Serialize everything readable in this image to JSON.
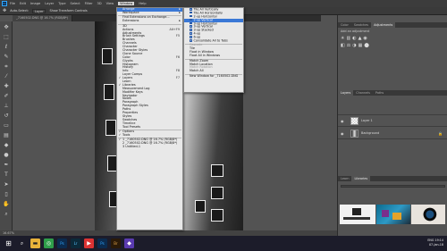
{
  "menubar": {
    "items": [
      "File",
      "Edit",
      "Image",
      "Layer",
      "Type",
      "Select",
      "Filter",
      "3D",
      "View",
      "Window",
      "Help"
    ],
    "active": "Window"
  },
  "optbar": {
    "autoselect": "Auto-Select:",
    "layer": "Layer",
    "transform": "Show Transform Controls"
  },
  "tabs": [
    "_7160502.DNG @ 16.7% (RGB/8*)"
  ],
  "window_menu": [
    {
      "label": "Arrange",
      "arrow": true,
      "hl": true
    },
    {
      "label": "Workspace",
      "arrow": true
    },
    {
      "sep": true
    },
    {
      "label": "Find Extensions on Exchange..."
    },
    {
      "label": "Extensions",
      "arrow": true
    },
    {
      "sep": true
    },
    {
      "label": "3D"
    },
    {
      "label": "Actions",
      "sc": "Alt+F9"
    },
    {
      "label": "Adjustments"
    },
    {
      "label": "Brush Settings",
      "sc": "F5"
    },
    {
      "label": "Brushes"
    },
    {
      "label": "Channels"
    },
    {
      "label": "Character"
    },
    {
      "label": "Character Styles"
    },
    {
      "label": "Clone Source"
    },
    {
      "label": "Color",
      "sc": "F6"
    },
    {
      "label": "Glyphs"
    },
    {
      "label": "Histogram"
    },
    {
      "label": "History"
    },
    {
      "label": "Info",
      "sc": "F8"
    },
    {
      "label": "Layer Comps"
    },
    {
      "label": "Layers",
      "sc": "F7",
      "chk": true
    },
    {
      "label": "Learn"
    },
    {
      "label": "Libraries",
      "chk": true
    },
    {
      "label": "Measurement Log"
    },
    {
      "label": "Modifier Keys"
    },
    {
      "label": "Navigator"
    },
    {
      "label": "Notes"
    },
    {
      "label": "Paragraph"
    },
    {
      "label": "Paragraph Styles"
    },
    {
      "label": "Paths"
    },
    {
      "label": "Properties"
    },
    {
      "label": "Styles"
    },
    {
      "label": "Swatches"
    },
    {
      "label": "Timeline"
    },
    {
      "label": "Tool Presets"
    },
    {
      "sep": true
    },
    {
      "label": "Options",
      "chk": true
    },
    {
      "label": "Tools",
      "chk": true
    },
    {
      "sep": true
    },
    {
      "label": "1 _7160502.DNG @ 16.7% (RGB/8*)",
      "chk": true
    },
    {
      "label": "2 _7160502.DNG @ 16.7% (RGB/8*)"
    },
    {
      "label": "3 Untitled-1"
    }
  ],
  "arrange_menu": [
    {
      "label": "Tile All Vertically",
      "icon": true
    },
    {
      "label": "Tile All Horizontally",
      "icon": true
    },
    {
      "label": "2-up Horizontal",
      "icon": true
    },
    {
      "label": "2-up Vertical",
      "icon": true,
      "hl": true
    },
    {
      "label": "3-up Horizontal",
      "icon": true
    },
    {
      "label": "3-up Vertical",
      "icon": true
    },
    {
      "label": "3-up Stacked",
      "icon": true
    },
    {
      "label": "4-up",
      "icon": true
    },
    {
      "label": "6-up",
      "icon": true
    },
    {
      "label": "Consolidate All to Tabs",
      "icon": true
    },
    {
      "sep": true
    },
    {
      "label": "Cascade",
      "dis": true
    },
    {
      "label": "Tile"
    },
    {
      "label": "Float in Window"
    },
    {
      "label": "Float All in Windows"
    },
    {
      "sep": true
    },
    {
      "label": "Match Zoom"
    },
    {
      "label": "Match Location"
    },
    {
      "label": "Match Rotation",
      "dis": true
    },
    {
      "label": "Match All"
    },
    {
      "sep": true
    },
    {
      "label": "New Window for _7160502.DNG"
    }
  ],
  "panels": {
    "top_tabs": [
      "Color",
      "Swatches",
      "Adjustments"
    ],
    "adjust_hint": "Add an adjustment",
    "layer_tabs": [
      "Layers",
      "Channels",
      "Paths"
    ],
    "layers": [
      {
        "name": "Layer 1"
      },
      {
        "name": "Background"
      }
    ],
    "lib_tabs": [
      "Learn",
      "Libraries"
    ]
  },
  "status": "16.67%",
  "tray": {
    "time": "19:14",
    "date": "07-Jan-18",
    "lang": "ENG"
  },
  "colors": {
    "accent": "#31a8ff",
    "highlight": "#3a78d6"
  }
}
